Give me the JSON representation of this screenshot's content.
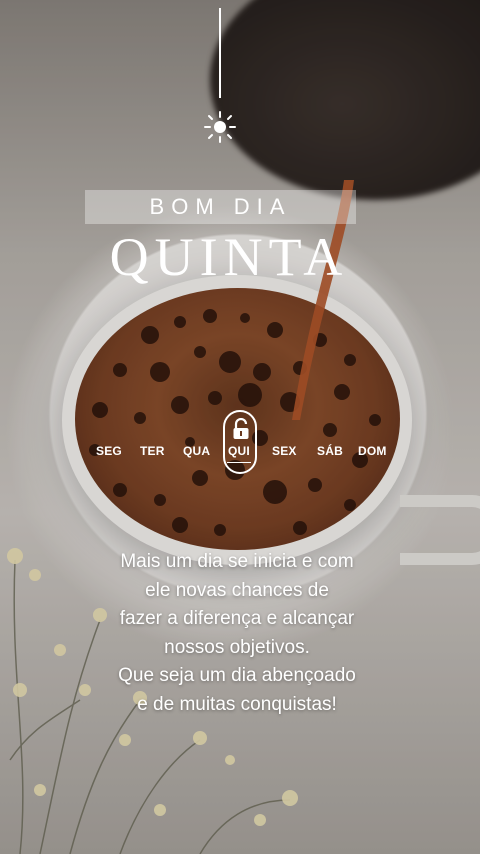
{
  "greeting": "BOM DIA",
  "day_name": "QUINTA",
  "weekdays": [
    "SEG",
    "TER",
    "QUA",
    "QUI",
    "SEX",
    "SÁB",
    "DOM"
  ],
  "selected_day": "QUI",
  "message": {
    "lines": [
      "Mais um dia se inicia e com",
      "ele novas chances de",
      "fazer a diferença e alcançar",
      "nossos objetivos.",
      "Que seja um dia abençoado",
      "e de muitas conquistas!"
    ]
  },
  "icons": {
    "sun": "sun-icon",
    "lock": "unlocked-padlock-icon"
  },
  "colors": {
    "text": "#ffffff",
    "coffee": "#7a4225",
    "cup": "#f6f4f1"
  }
}
